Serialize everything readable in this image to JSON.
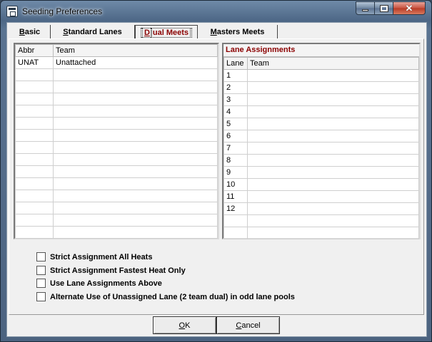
{
  "window": {
    "title": "Seeding Preferences"
  },
  "tabs": [
    {
      "label": "Basic",
      "accel": "B",
      "rest": "asic"
    },
    {
      "label": "Standard Lanes",
      "accel": "S",
      "rest": "tandard Lanes"
    },
    {
      "label": "Dual Meets",
      "accel": "D",
      "rest": "ual Meets"
    },
    {
      "label": "Masters Meets",
      "accel": "M",
      "rest": "asters Meets"
    }
  ],
  "teams_grid": {
    "columns": [
      "Abbr",
      "Team"
    ],
    "rows": [
      [
        "UNAT",
        "Unattached"
      ]
    ]
  },
  "lanes_grid": {
    "title": "Lane Assignments",
    "columns": [
      "Lane",
      "Team"
    ],
    "lanes": [
      "1",
      "2",
      "3",
      "4",
      "5",
      "6",
      "7",
      "8",
      "9",
      "10",
      "11",
      "12"
    ]
  },
  "options": [
    "Strict Assignment All Heats",
    "Strict Assignment Fastest Heat Only",
    "Use Lane Assignments Above",
    "Alternate Use of Unassigned Lane (2 team dual) in odd lane pools"
  ],
  "buttons": {
    "ok": {
      "accel": "O",
      "rest": "K"
    },
    "cancel": {
      "accel": "C",
      "rest": "ancel"
    }
  }
}
